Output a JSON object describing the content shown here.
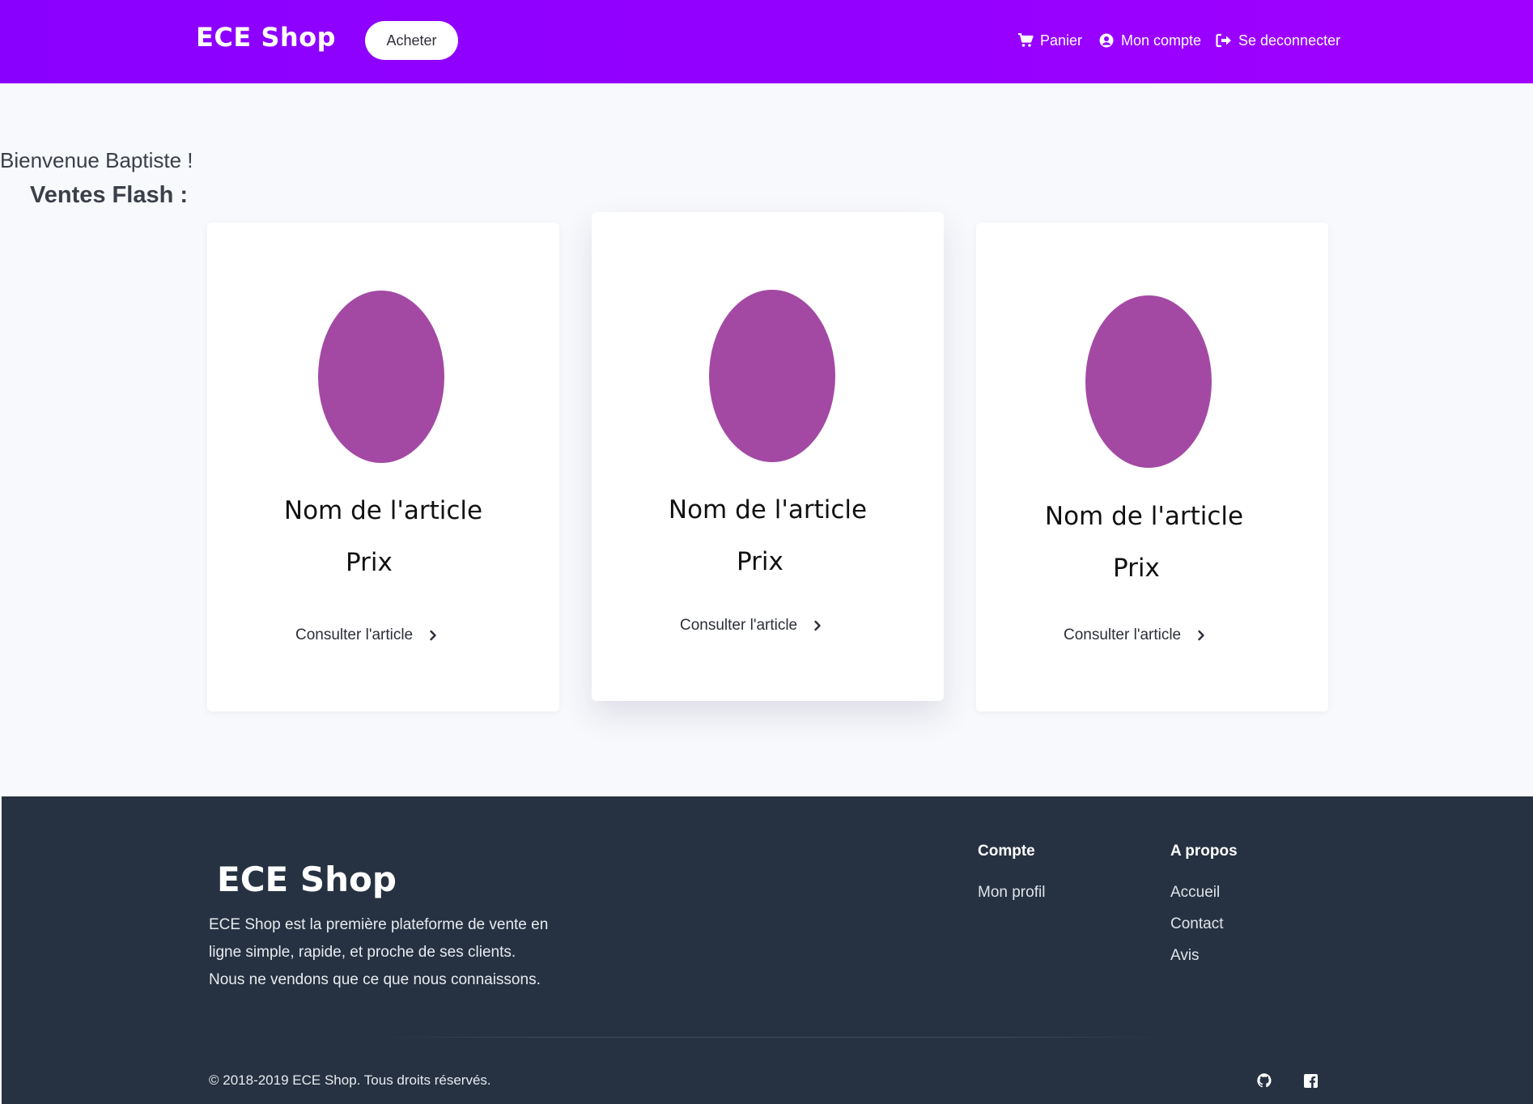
{
  "header": {
    "brand": "ECE Shop",
    "buy_button": "Acheter",
    "nav": {
      "cart": "Panier",
      "account": "Mon compte",
      "logout": "Se deconnecter"
    }
  },
  "main": {
    "welcome": "Bienvenue Baptiste !",
    "flash_title": "Ventes Flash :",
    "cards": [
      {
        "name": "Nom de l'article",
        "price": "Prix",
        "link": "Consulter l'article"
      },
      {
        "name": "Nom de l'article",
        "price": "Prix",
        "link": "Consulter l'article"
      },
      {
        "name": "Nom de l'article",
        "price": "Prix",
        "link": "Consulter l'article"
      }
    ]
  },
  "footer": {
    "brand": "ECE Shop",
    "description": [
      "ECE Shop est la première plateforme de vente en",
      "ligne simple, rapide, et proche de ses clients.",
      "Nous ne vendons que ce que nous connaissons."
    ],
    "columns": [
      {
        "title": "Compte",
        "links": [
          "Mon profil"
        ]
      },
      {
        "title": "A propos",
        "links": [
          "Accueil",
          "Contact",
          "Avis"
        ]
      }
    ],
    "copyright": "© 2018-2019 ECE Shop. Tous droits réservés.",
    "social_icons": [
      "github-icon",
      "facebook-icon"
    ]
  },
  "colors": {
    "header_gradient_start": "#8a00ff",
    "header_gradient_end": "#a000ff",
    "product_image": "#a349a4",
    "footer_bg": "#263241",
    "page_bg": "#f8f9fc"
  }
}
